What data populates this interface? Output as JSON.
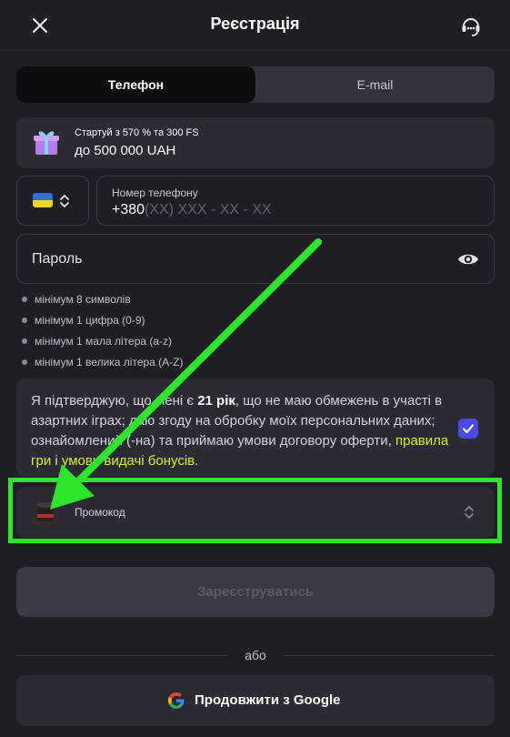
{
  "header": {
    "title": "Реєстрація"
  },
  "tabs": [
    {
      "label": "Телефон",
      "active": true
    },
    {
      "label": "E-mail",
      "active": false
    }
  ],
  "bonus": {
    "line1": "Стартуй з 570 % та 300 FS",
    "line2": "до 500 000 UAH"
  },
  "phone": {
    "label": "Номер телефону",
    "prefix": "+380",
    "mask": "(XX) XXX - XX - XX"
  },
  "password": {
    "label": "Пароль"
  },
  "rules": [
    "мінімум 8 символів",
    "мінімум 1 цифра (0-9)",
    "мінімум 1 мала літера (a-z)",
    "мінімум 1 велика літера (A-Z)"
  ],
  "consent": {
    "text_before": "Я підтверджую, що мені є ",
    "age": "21 рік",
    "text_middle": ", що не маю обмежень в участі в азартних іграх; даю згоду на обробку моїх персональних даних; ознайомлений (-на) та приймаю умови договору оферти, ",
    "link_rules": "правила гри",
    "and": " і ",
    "link_bonus": "умови видачі бонусів",
    "end": ".",
    "checked": true
  },
  "promo": {
    "label": "Промокод"
  },
  "register": {
    "label": "Зареєструватись"
  },
  "divider": {
    "text": "або"
  },
  "google": {
    "label": "Продовжити з Google"
  },
  "colors": {
    "background": "#1e1e24",
    "card": "#2b2b33",
    "accent_link": "#d8ee32",
    "checkbox": "#4a4ae2",
    "highlight": "#2ee52e"
  }
}
